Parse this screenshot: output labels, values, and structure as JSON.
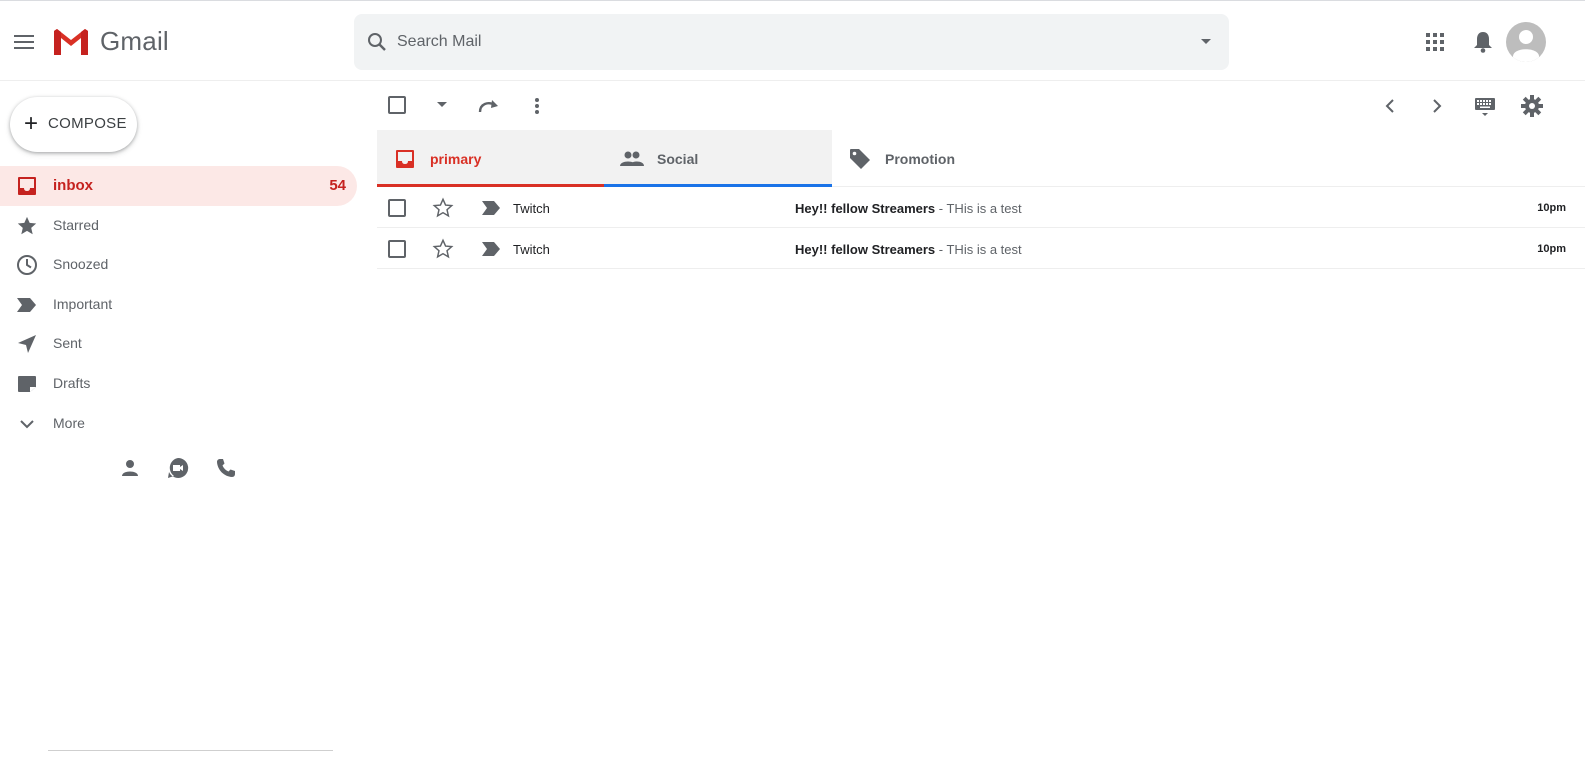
{
  "app": {
    "name": "Gmail"
  },
  "search": {
    "placeholder": "Search Mail",
    "value": ""
  },
  "compose": {
    "label": "COMPOSE"
  },
  "sidebar": {
    "items": [
      {
        "label": "inbox",
        "count": "54",
        "icon": "inbox-icon",
        "active": true
      },
      {
        "label": "Starred",
        "icon": "star-icon"
      },
      {
        "label": "Snoozed",
        "icon": "clock-icon"
      },
      {
        "label": "Important",
        "icon": "label-important-icon"
      },
      {
        "label": "Sent",
        "icon": "send-icon"
      },
      {
        "label": "Drafts",
        "icon": "drafts-icon"
      },
      {
        "label": "More",
        "icon": "chevron-down-icon"
      }
    ],
    "bottom_icons": [
      "person-icon",
      "duo-video-icon",
      "phone-icon"
    ]
  },
  "tabs": [
    {
      "label": "primary",
      "icon": "inbox-icon",
      "active": true,
      "color": "#d93025"
    },
    {
      "label": "Social",
      "icon": "people-icon",
      "color": "#1a73e8"
    },
    {
      "label": "Promotion",
      "icon": "tag-icon"
    }
  ],
  "messages": [
    {
      "sender": "Twitch",
      "subject": "Hey!! fellow Streamers",
      "snippet": " - THis is a test",
      "time": "10pm"
    },
    {
      "sender": "Twitch",
      "subject": "Hey!! fellow Streamers",
      "snippet": " - THis is a test",
      "time": "10pm"
    }
  ],
  "colors": {
    "accent": "#c5221f",
    "primary_tab": "#d93025",
    "social_tab": "#1a73e8",
    "active_bg": "#fce8e6"
  }
}
